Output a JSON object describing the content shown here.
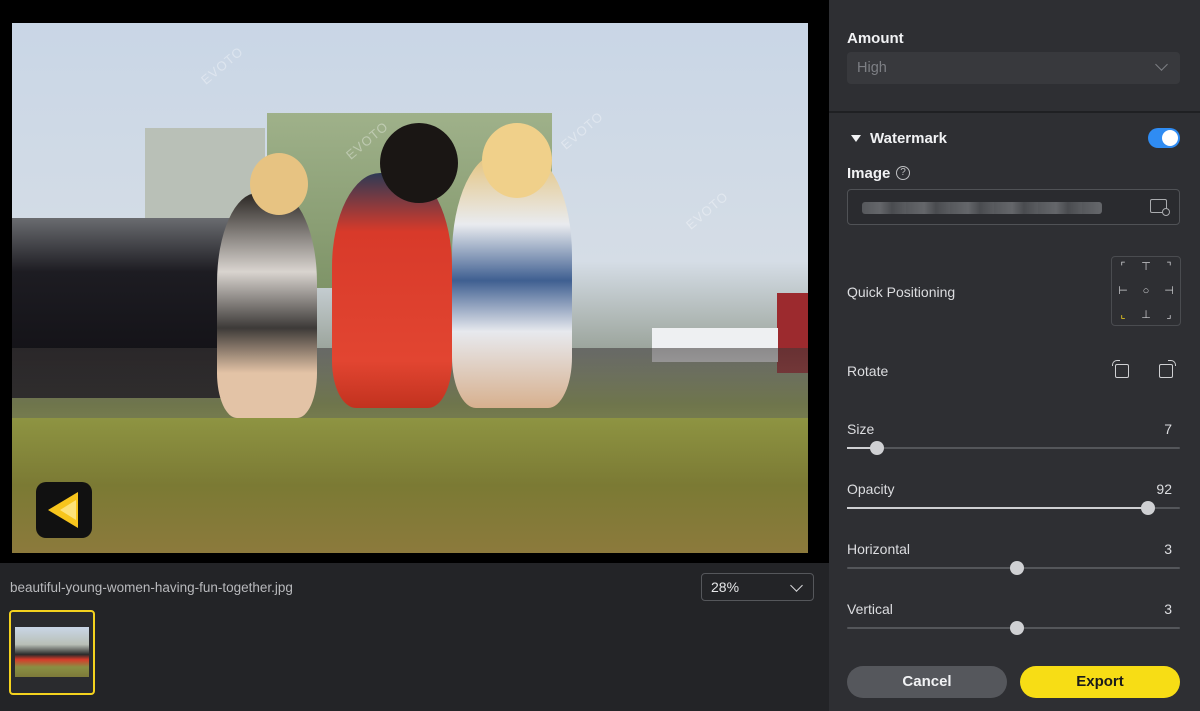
{
  "preview": {
    "filename": "beautiful-young-women-having-fun-together.jpg",
    "zoom": "28%",
    "watermark_text": "EVOTO"
  },
  "panel": {
    "amount_label": "Amount",
    "amount_value": "High",
    "watermark_label": "Watermark",
    "watermark_enabled": true,
    "image_label": "Image",
    "help_glyph": "?",
    "quick_positioning_label": "Quick Positioning",
    "quick_positioning_selected": "bottom-left",
    "rotate_label": "Rotate",
    "sliders": {
      "size": {
        "label": "Size",
        "value": "7",
        "fraction": 0.09
      },
      "opacity": {
        "label": "Opacity",
        "value": "92",
        "fraction": 0.905
      },
      "horizontal": {
        "label": "Horizontal",
        "value": "3",
        "fraction": 0.51
      },
      "vertical": {
        "label": "Vertical",
        "value": "3",
        "fraction": 0.51
      }
    },
    "cancel_label": "Cancel",
    "export_label": "Export"
  },
  "colors": {
    "accent_toggle": "#2f8cf3",
    "accent_export": "#f7dd15",
    "thumbnail_selected_border": "#f4d21e"
  }
}
